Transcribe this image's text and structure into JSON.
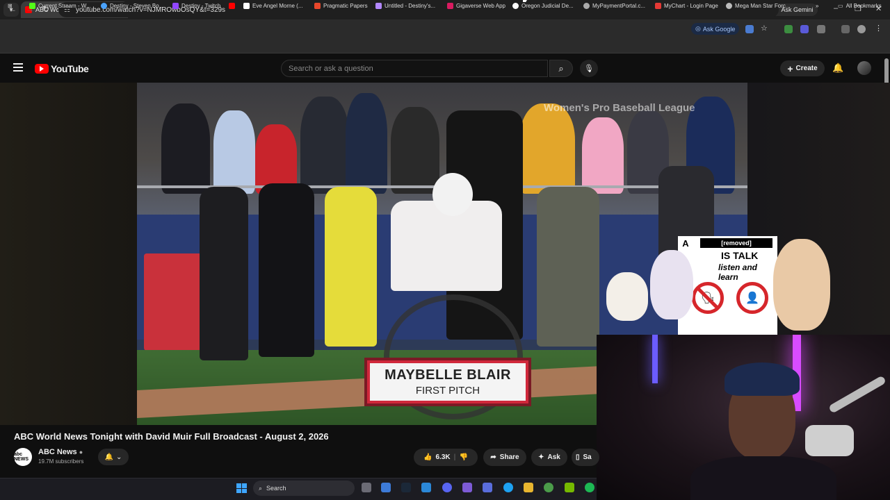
{
  "browser": {
    "tab_title": "ABC World News Tonight w",
    "tab_close": "✕",
    "new_tab": "+",
    "ask_gemini": "Ask Gemini",
    "url": "youtube.com/watch?v=NJMROwbOsQY&t=329s",
    "ask_google": "Ask Google",
    "all_bookmarks": "All Bookmarks",
    "bookmarks": [
      {
        "label": "Current Stream - W...",
        "color": "#53fc18"
      },
      {
        "label": "Destiny - Steven Bo...",
        "color": "#4aa3ff"
      },
      {
        "label": "Destiny - Twitch",
        "color": "#9146ff"
      },
      {
        "label": "",
        "color": "#ff0000"
      },
      {
        "label": "Eve Angel Morne (...",
        "color": "#ffffff"
      },
      {
        "label": "Pragmatic Papers",
        "color": "#e8472b"
      },
      {
        "label": "Untitled - Destiny's...",
        "color": "#b388ff"
      },
      {
        "label": "Gigaverse Web App",
        "color": "#d81b60"
      },
      {
        "label": "Oregon Judicial De...",
        "color": "#ffffff"
      },
      {
        "label": "MyPaymentPortal.c...",
        "color": "#aaaaaa"
      },
      {
        "label": "MyChart - Login Page",
        "color": "#e53935"
      },
      {
        "label": "Mega Man Star Forc...",
        "color": "#bbbbbb"
      }
    ]
  },
  "youtube": {
    "logo_text": "YouTube",
    "search_placeholder": "Search or ask a question",
    "create_label": "Create",
    "video": {
      "watermark": "Women's Pro Baseball League",
      "lower_third_name": "MAYBELLE BLAIR",
      "lower_third_sub": "FIRST PITCH"
    },
    "title": "ABC World News Tonight with David Muir Full Broadcast - August 2, 2026",
    "channel": {
      "name": "ABC News",
      "subscribers": "19.7M subscribers",
      "avatar_text": "abc NEWS"
    },
    "actions": {
      "likes": "6.3K",
      "share": "Share",
      "ask": "Ask",
      "save": "Sa"
    }
  },
  "overlay": {
    "letter": "A",
    "redacted_text": "[removed]",
    "line2": "IS TALK",
    "line3": "listen and learn"
  },
  "taskbar": {
    "search_label": "Search"
  },
  "colors": {
    "youtube_red": "#ff0000",
    "lower_third_border": "#d0283b",
    "accent_blue": "#3ea6ff"
  }
}
